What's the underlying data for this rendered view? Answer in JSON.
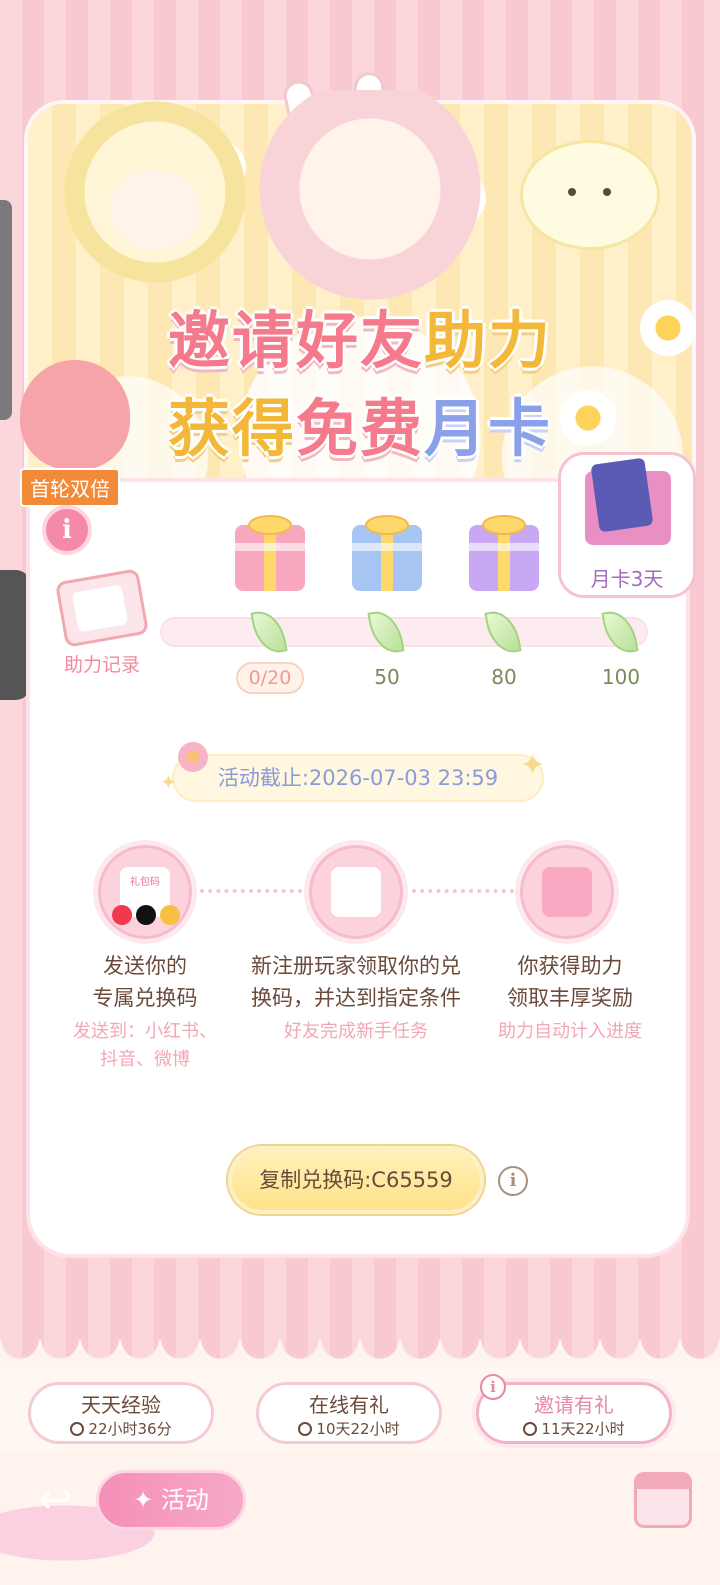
{
  "banner": {
    "badge": "首轮双倍",
    "title_line1_part1": "邀请好友",
    "title_line1_part2": "助力",
    "title_line2_part1": "获得",
    "title_line2_part2": "免费",
    "title_line2_part3": "月卡"
  },
  "progress": {
    "record_label": "助力记录",
    "current": "0/20",
    "milestones": [
      "50",
      "80",
      "100"
    ],
    "final_reward_label": "月卡3天"
  },
  "deadline": "活动截止:2026-07-03 23:59",
  "steps": [
    {
      "title_line1": "发送你的",
      "title_line2": "专属兑换码",
      "sub_line1": "发送到：小红书、",
      "sub_line2": "抖音、微博",
      "icon_badge": "礼包码"
    },
    {
      "title_line1": "新注册玩家领取你的兑",
      "title_line2": "换码，并达到指定条件",
      "sub_line1": "好友完成新手任务"
    },
    {
      "title_line1": "你获得助力",
      "title_line2": "领取丰厚奖励",
      "sub_line1": "助力自动计入进度"
    }
  ],
  "copy_button": "复制兑换码:C65559",
  "tabs": [
    {
      "label": "天天经验",
      "time": "22小时36分"
    },
    {
      "label": "在线有礼",
      "time": "10天22小时"
    },
    {
      "label": "邀请有礼",
      "time": "11天22小时"
    }
  ],
  "bottom": {
    "activity_label": "✦ 活动"
  },
  "colors": {
    "accent_pink": "#f57a8c",
    "accent_gold": "#f3b83a",
    "accent_blue": "#8aa0e8"
  }
}
